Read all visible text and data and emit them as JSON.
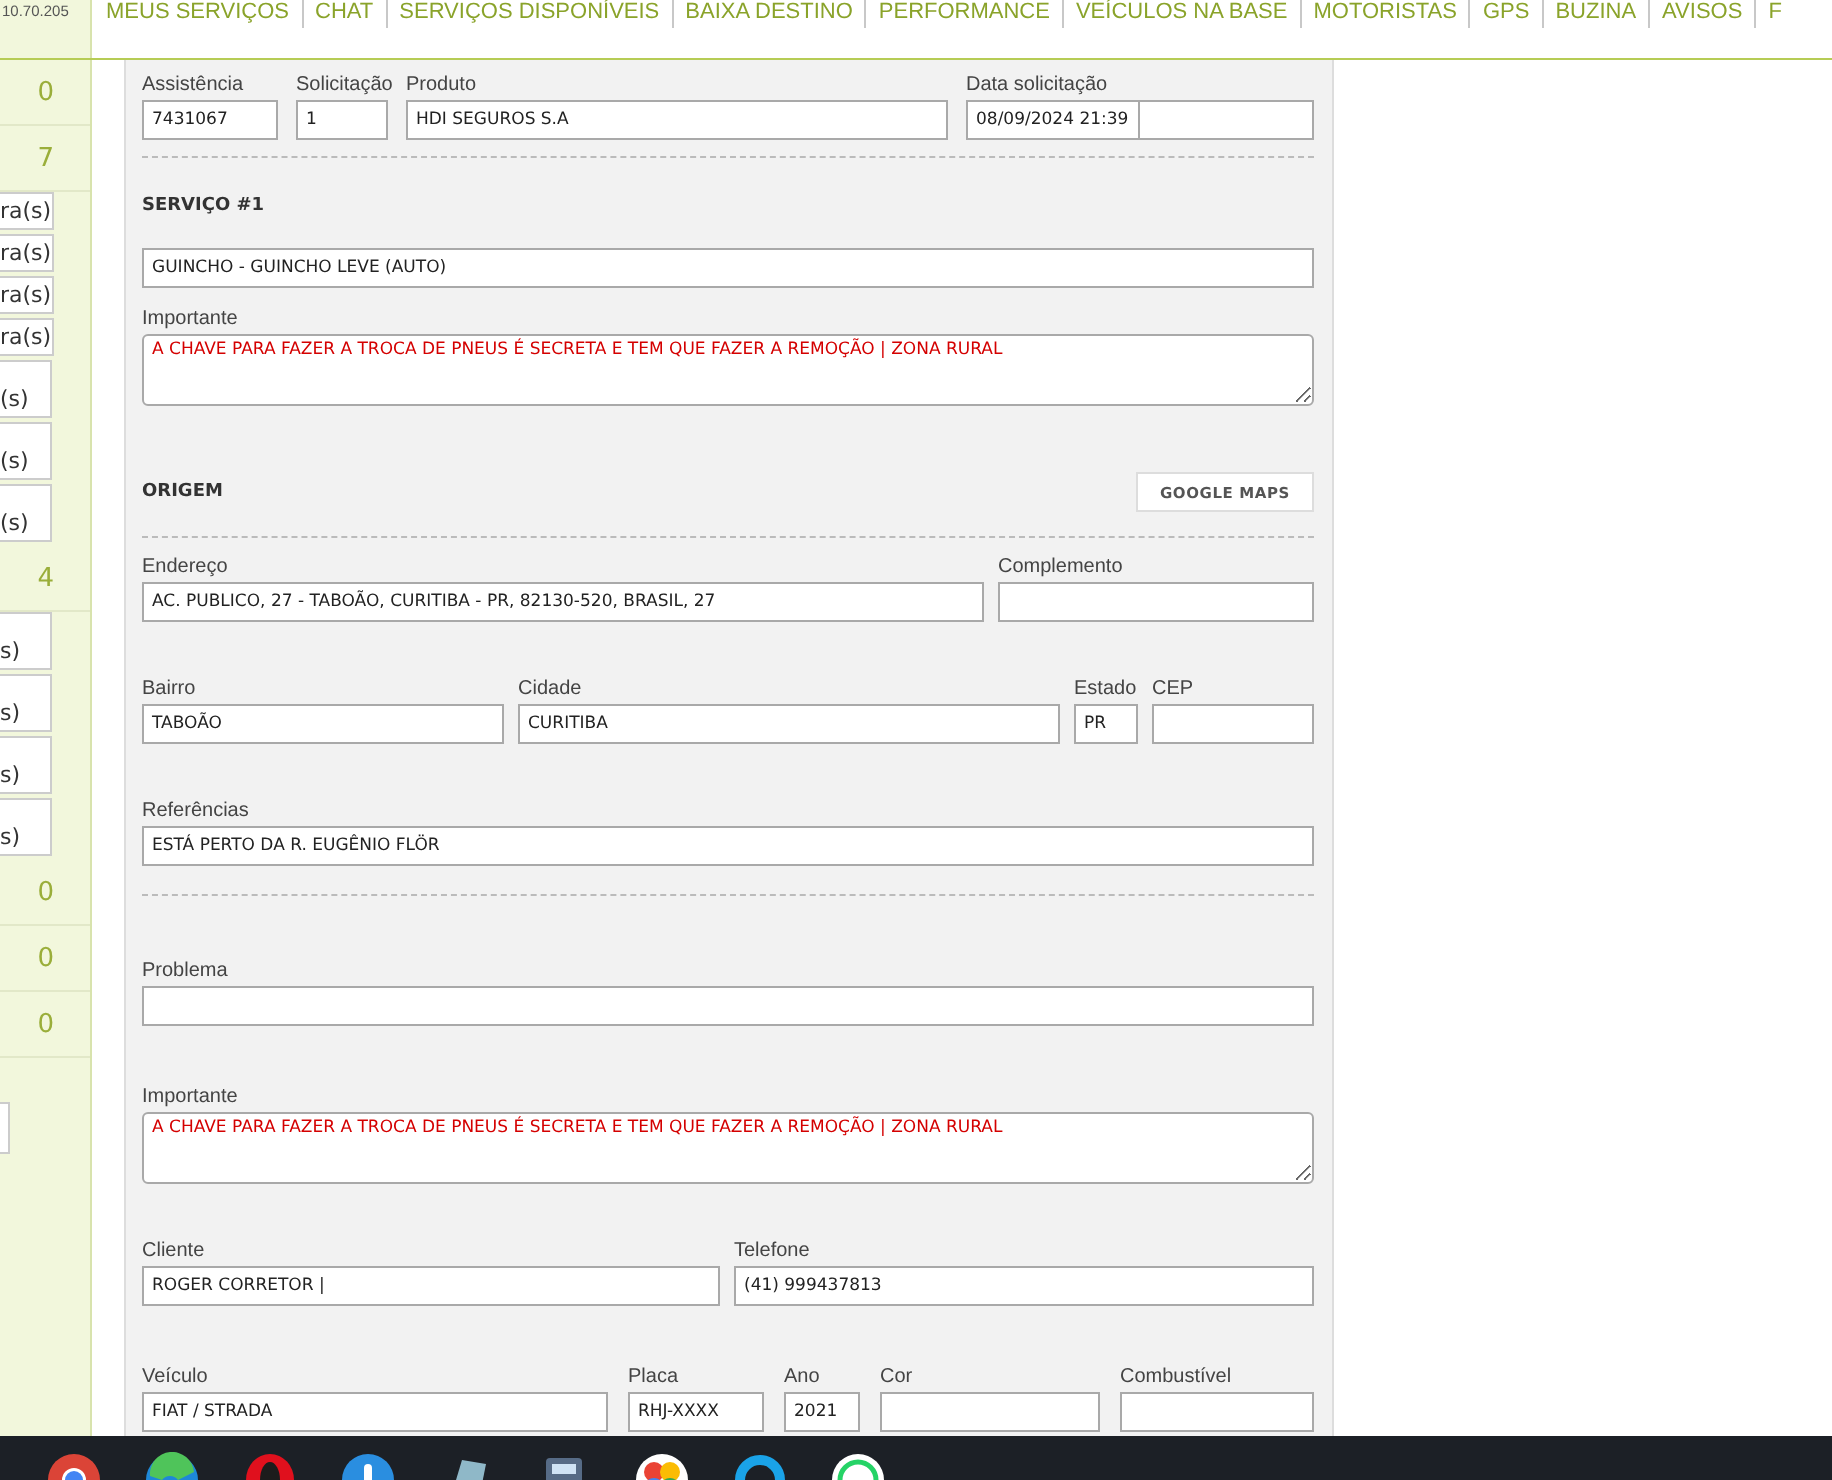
{
  "top_bar": {
    "address": "10.70.205",
    "nav": [
      {
        "label": "MEUS SERVIÇOS"
      },
      {
        "label": "CHAT"
      },
      {
        "label": "SERVIÇOS DISPONÍVEIS"
      },
      {
        "label": "BAIXA DESTINO"
      },
      {
        "label": "PERFORMANCE"
      },
      {
        "label": "VEÍCULOS NA BASE"
      },
      {
        "label": "MOTORISTAS"
      },
      {
        "label": "GPS"
      },
      {
        "label": "BUZINA"
      },
      {
        "label": "AVISOS"
      },
      {
        "label": "F"
      }
    ]
  },
  "sidebar": {
    "items": [
      {
        "kind": "count",
        "text": "0"
      },
      {
        "kind": "count",
        "text": "7"
      },
      {
        "kind": "box",
        "text": "ra(s)"
      },
      {
        "kind": "box",
        "text": "ra(s)"
      },
      {
        "kind": "box",
        "text": "ra(s)"
      },
      {
        "kind": "box",
        "text": "ra(s)"
      },
      {
        "kind": "tall_box",
        "text": "(s)"
      },
      {
        "kind": "tall_box",
        "text": "(s)"
      },
      {
        "kind": "tall_box",
        "text": "(s)"
      },
      {
        "kind": "count",
        "text": "4"
      },
      {
        "kind": "tall_box",
        "text": "s)"
      },
      {
        "kind": "tall_box",
        "text": "s)"
      },
      {
        "kind": "tall_box",
        "text": "s)"
      },
      {
        "kind": "tall_box",
        "text": "s)"
      },
      {
        "kind": "count",
        "text": "0"
      },
      {
        "kind": "count",
        "text": "0"
      },
      {
        "kind": "count",
        "text": "0"
      },
      {
        "kind": "field"
      }
    ]
  },
  "form": {
    "blocks": [
      {
        "kind": "fields",
        "fields": [
          {
            "label": "Assistência",
            "value": "7431067"
          },
          {
            "label": "Solicitação",
            "value": "1"
          },
          {
            "label": "Produto",
            "value": "HDI SEGUROS S.A"
          },
          {
            "label": "Data solicitação",
            "value": "08/09/2024 21:39",
            "kind": "split"
          }
        ]
      },
      {
        "kind": "divider"
      },
      {
        "kind": "heading",
        "title": "SERVIÇO #1"
      },
      {
        "kind": "fields",
        "fields": [
          {
            "value": "GUINCHO - GUINCHO LEVE (AUTO)"
          }
        ]
      },
      {
        "kind": "note",
        "label": "Importante",
        "value": "A CHAVE PARA FAZER A TROCA DE PNEUS É SECRETA E TEM QUE FAZER A REMOÇÃO | ZONA RURAL"
      },
      {
        "kind": "heading",
        "title": "ORIGEM",
        "button": "GOOGLE MAPS"
      },
      {
        "kind": "divider"
      },
      {
        "kind": "fields",
        "fields": [
          {
            "label": "Endereço",
            "value": "AC. PUBLICO, 27 - TABOÃO, CURITIBA - PR, 82130-520, BRASIL, 27"
          },
          {
            "label": "Complemento"
          }
        ]
      },
      {
        "kind": "fields",
        "fields": [
          {
            "label": "Bairro",
            "value": "TABOÃO"
          },
          {
            "label": "Cidade",
            "value": "CURITIBA"
          },
          {
            "label": "Estado",
            "value": "PR"
          },
          {
            "label": "CEP"
          }
        ]
      },
      {
        "kind": "fields",
        "fields": [
          {
            "label": "Referências",
            "value": "ESTÁ PERTO DA R. EUGÊNIO FLÖR"
          }
        ]
      },
      {
        "kind": "divider"
      },
      {
        "kind": "fields",
        "fields": [
          {
            "label": "Problema"
          }
        ]
      },
      {
        "kind": "note",
        "label": "Importante",
        "value": "A CHAVE PARA FAZER A TROCA DE PNEUS É SECRETA E TEM QUE FAZER A REMOÇÃO | ZONA RURAL"
      },
      {
        "kind": "fields",
        "fields": [
          {
            "label": "Cliente",
            "value": "ROGER CORRETOR |"
          },
          {
            "label": "Telefone",
            "value": "(41) 999437813"
          }
        ]
      },
      {
        "kind": "fields",
        "fields": [
          {
            "label": "Veículo",
            "value": "FIAT / STRADA"
          },
          {
            "label": "Placa",
            "value": "RHJ-XXXX"
          },
          {
            "label": "Ano",
            "value": "2021"
          },
          {
            "label": "Cor"
          },
          {
            "label": "Combustível"
          }
        ]
      }
    ]
  }
}
